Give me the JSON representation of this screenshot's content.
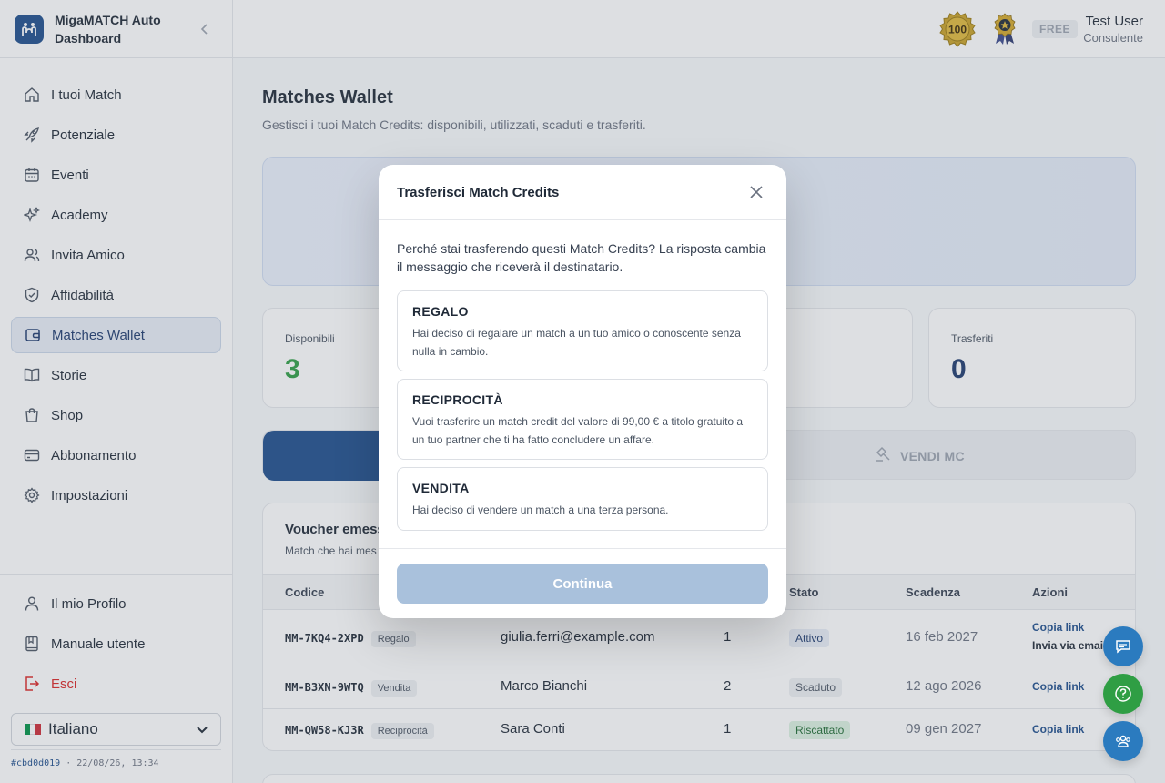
{
  "app": {
    "name": "MigaMATCH Auto Dashboard"
  },
  "sidebar": {
    "items": [
      {
        "label": "I tuoi Match",
        "icon": "home-icon"
      },
      {
        "label": "Potenziale",
        "icon": "rocket-icon"
      },
      {
        "label": "Eventi",
        "icon": "calendar-icon"
      },
      {
        "label": "Academy",
        "icon": "sparkles-icon"
      },
      {
        "label": "Invita Amico",
        "icon": "users-icon"
      },
      {
        "label": "Affidabilità",
        "icon": "shield-check-icon"
      },
      {
        "label": "Matches Wallet",
        "icon": "wallet-icon",
        "active": true
      },
      {
        "label": "Storie",
        "icon": "book-open-icon"
      },
      {
        "label": "Shop",
        "icon": "shopping-bag-icon"
      },
      {
        "label": "Abbonamento",
        "icon": "credit-card-icon"
      },
      {
        "label": "Impostazioni",
        "icon": "gear-icon"
      }
    ],
    "bottom": [
      {
        "label": "Il mio Profilo",
        "icon": "user-icon"
      },
      {
        "label": "Manuale utente",
        "icon": "book-icon"
      },
      {
        "label": "Esci",
        "icon": "logout-icon"
      }
    ],
    "language": {
      "selected": "Italiano"
    },
    "build": {
      "hash": "#cbd0d019",
      "date": "22/08/26, 13:34"
    }
  },
  "topbar": {
    "badge_value": "100",
    "plan": "FREE",
    "user_name": "Test User",
    "user_role": "Consulente"
  },
  "page": {
    "title": "Matches Wallet",
    "subtitle": "Gestisci i tuoi Match Credits: disponibili, utilizzati, scaduti e trasferiti."
  },
  "stats": [
    {
      "label": "Disponibili",
      "value": "3",
      "color": "#2f9e44"
    },
    {
      "label": "Trasferiti",
      "value": "0",
      "color": "#1e3a6e"
    }
  ],
  "tabs": {
    "sell_label": "VENDI MC"
  },
  "vouchers": {
    "title": "Voucher emess",
    "subtitle": "Match che hai mes",
    "columns": [
      "Codice",
      "Stato",
      "Scadenza",
      "Azioni"
    ],
    "rows": [
      {
        "code": "MM-7KQ4-2XPD",
        "type": "Regalo",
        "recipient": "giulia.ferri@example.com",
        "qty": "1",
        "status": "Attivo",
        "expiry": "16 feb 2027",
        "action1": "Copia link",
        "action2": "Invia via email"
      },
      {
        "code": "MM-B3XN-9WTQ",
        "type": "Vendita",
        "recipient": "Marco Bianchi",
        "qty": "2",
        "status": "Scaduto",
        "expiry": "12 ago 2026",
        "action1": "Copia link"
      },
      {
        "code": "MM-QW58-KJ3R",
        "type": "Reciprocità",
        "recipient": "Sara Conti",
        "qty": "1",
        "status": "Riscattato",
        "expiry": "09 gen 2027",
        "action1": "Copia link"
      }
    ]
  },
  "modal": {
    "title": "Trasferisci Match Credits",
    "question": "Perché stai trasferendo questi Match Credits? La risposta cambia il messaggio che riceverà il destinatario.",
    "options": [
      {
        "title": "REGALO",
        "desc": "Hai deciso di regalare un match a un tuo amico o conoscente senza nulla in cambio."
      },
      {
        "title": "RECIPROCITÀ",
        "desc": "Vuoi trasferire un match credit del valore di 99,00 € a titolo gratuito a un tuo partner che ti ha fatto concludere un affare."
      },
      {
        "title": "VENDITA",
        "desc": "Hai deciso di vendere un match a una terza persona."
      }
    ],
    "continue_label": "Continua"
  },
  "colors": {
    "brand": "#1e4e8c",
    "accent_green": "#2f9e44",
    "danger": "#dc2626"
  }
}
